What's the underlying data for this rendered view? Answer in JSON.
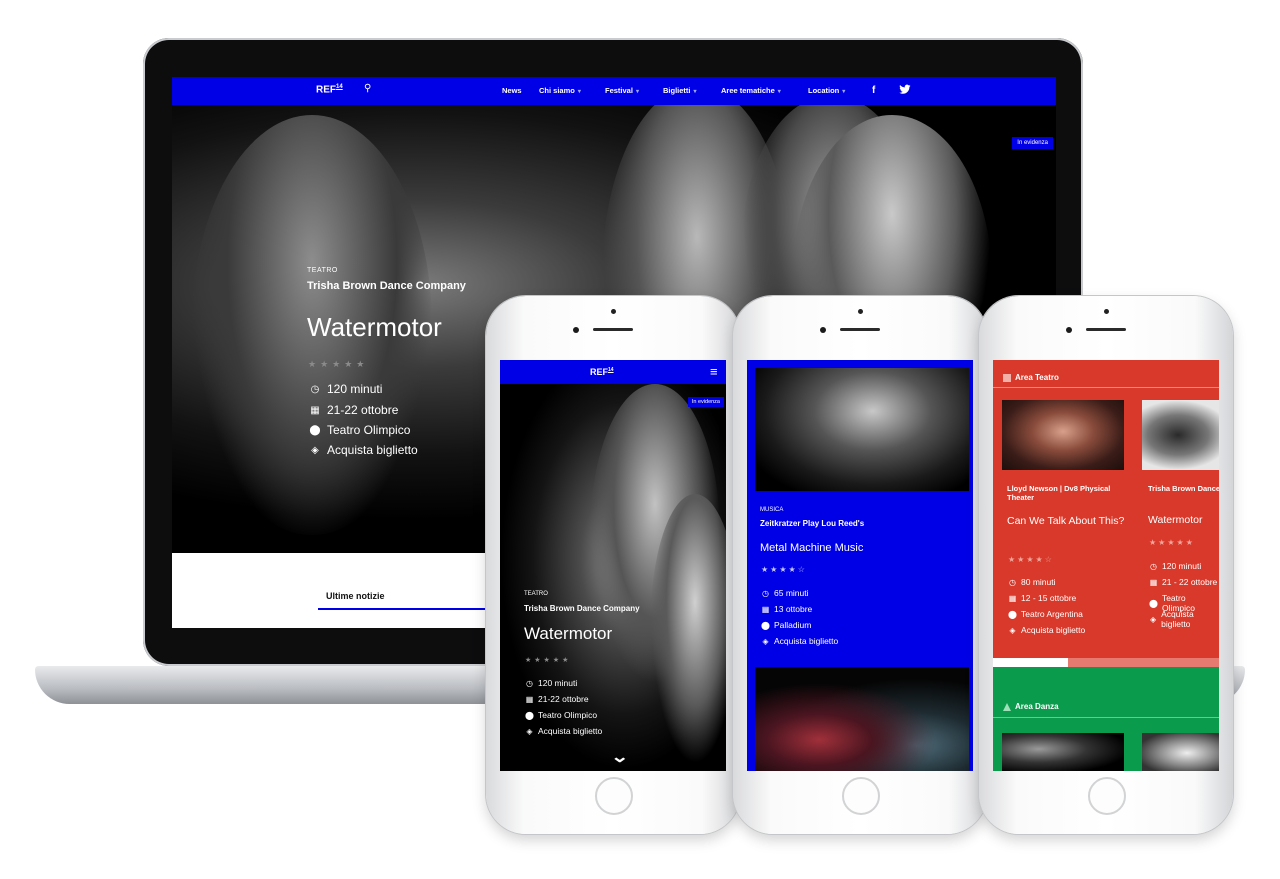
{
  "colors": {
    "accent": "#0000e6",
    "teatro_red": "#d8392b",
    "danza_green": "#0a9b4c"
  },
  "laptop": {
    "nav": {
      "logo": "REF",
      "logo_sup": "14",
      "items": [
        {
          "label": "News",
          "caret": false
        },
        {
          "label": "Chi siamo",
          "caret": true
        },
        {
          "label": "Festival",
          "caret": true
        },
        {
          "label": "Biglietti",
          "caret": true
        },
        {
          "label": "Aree tematiche",
          "caret": true
        },
        {
          "label": "Location",
          "caret": true
        }
      ],
      "search_icon": "search-icon",
      "facebook": "f",
      "twitter_icon": "twitter-icon"
    },
    "badge": "In evidenza",
    "event": {
      "category": "TEATRO",
      "company": "Trisha Brown Dance Company",
      "title": "Watermotor",
      "rating": 5,
      "stars": "★★★★★",
      "duration": "120 minuti",
      "dates": "21-22 ottobre",
      "venue": "Teatro Olimpico",
      "ticket": "Acquista biglietto"
    },
    "news_label": "Ultime notizie"
  },
  "phone1": {
    "logo": "REF",
    "logo_sup": "14",
    "badge": "In evidenza",
    "category": "TEATRO",
    "company": "Trisha Brown Dance Company",
    "title": "Watermotor",
    "stars": "★★★★★",
    "duration": "120 minuti",
    "dates": "21-22 ottobre",
    "venue": "Teatro Olimpico",
    "ticket": "Acquista biglietto"
  },
  "phone2": {
    "category": "MUSICA",
    "company": "Zeitkratzer Play Lou Reed's",
    "title": "Metal Machine Music",
    "stars": "★★★★☆",
    "duration": "65 minuti",
    "dates": "13 ottobre",
    "venue": "Palladium",
    "ticket": "Acquista biglietto"
  },
  "phone3": {
    "area_teatro": "Area Teatro",
    "area_danza": "Area Danza",
    "cards": [
      {
        "company": "Lloyd Newson | Dv8 Physical Theater",
        "title": "Can We Talk About This?",
        "stars": "★★★★☆",
        "duration": "80 minuti",
        "dates": "12 - 15 ottobre",
        "venue": "Teatro Argentina",
        "ticket": "Acquista biglietto"
      },
      {
        "company": "Trisha Brown Dance Company",
        "title": "Watermotor",
        "stars": "★★★★★",
        "duration": "120 minuti",
        "dates": "21 - 22 ottobre",
        "venue": "Teatro Olimpico",
        "ticket": "Acquista biglietto"
      }
    ]
  }
}
